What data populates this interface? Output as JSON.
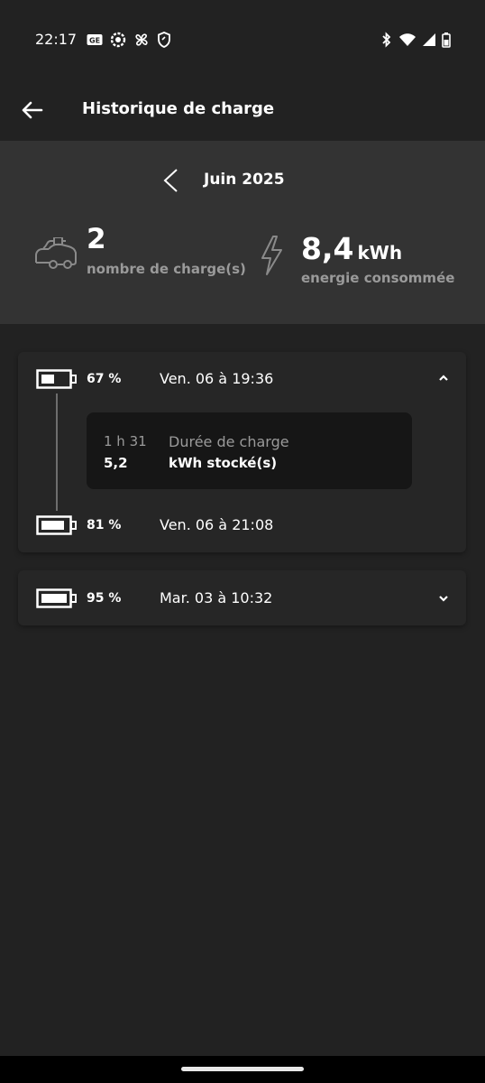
{
  "status_bar": {
    "time": "22:17",
    "left_icons": [
      "app-ge-icon",
      "gear-badge-icon",
      "pinwheel-icon",
      "shield-icon"
    ],
    "right_icons": [
      "bluetooth-icon",
      "wifi-icon",
      "signal-icon",
      "battery-icon"
    ]
  },
  "appbar": {
    "title": "Historique de charge"
  },
  "summary": {
    "month": "Juin 2025",
    "charge_count": "2",
    "charge_count_label": "nombre de charge(s)",
    "energy_value": "8,4",
    "energy_unit": "kWh",
    "energy_label": "energie consommée"
  },
  "sessions": [
    {
      "start_pct": "67 %",
      "start_date": "Ven. 06 à 19:36",
      "duration": "1 h 31",
      "duration_label": "Durée de charge",
      "stored": "5,2",
      "stored_label": "kWh stocké(s)",
      "end_pct": "81 %",
      "end_date": "Ven. 06 à 21:08",
      "expanded": true
    },
    {
      "start_pct": "95 %",
      "start_date": "Mar. 03 à 10:32",
      "expanded": false
    }
  ],
  "colors": {
    "background": "#222222",
    "summary_background": "#333333",
    "card_background": "#262626",
    "detail_background": "#161616",
    "muted_text": "#9a9a9a"
  }
}
